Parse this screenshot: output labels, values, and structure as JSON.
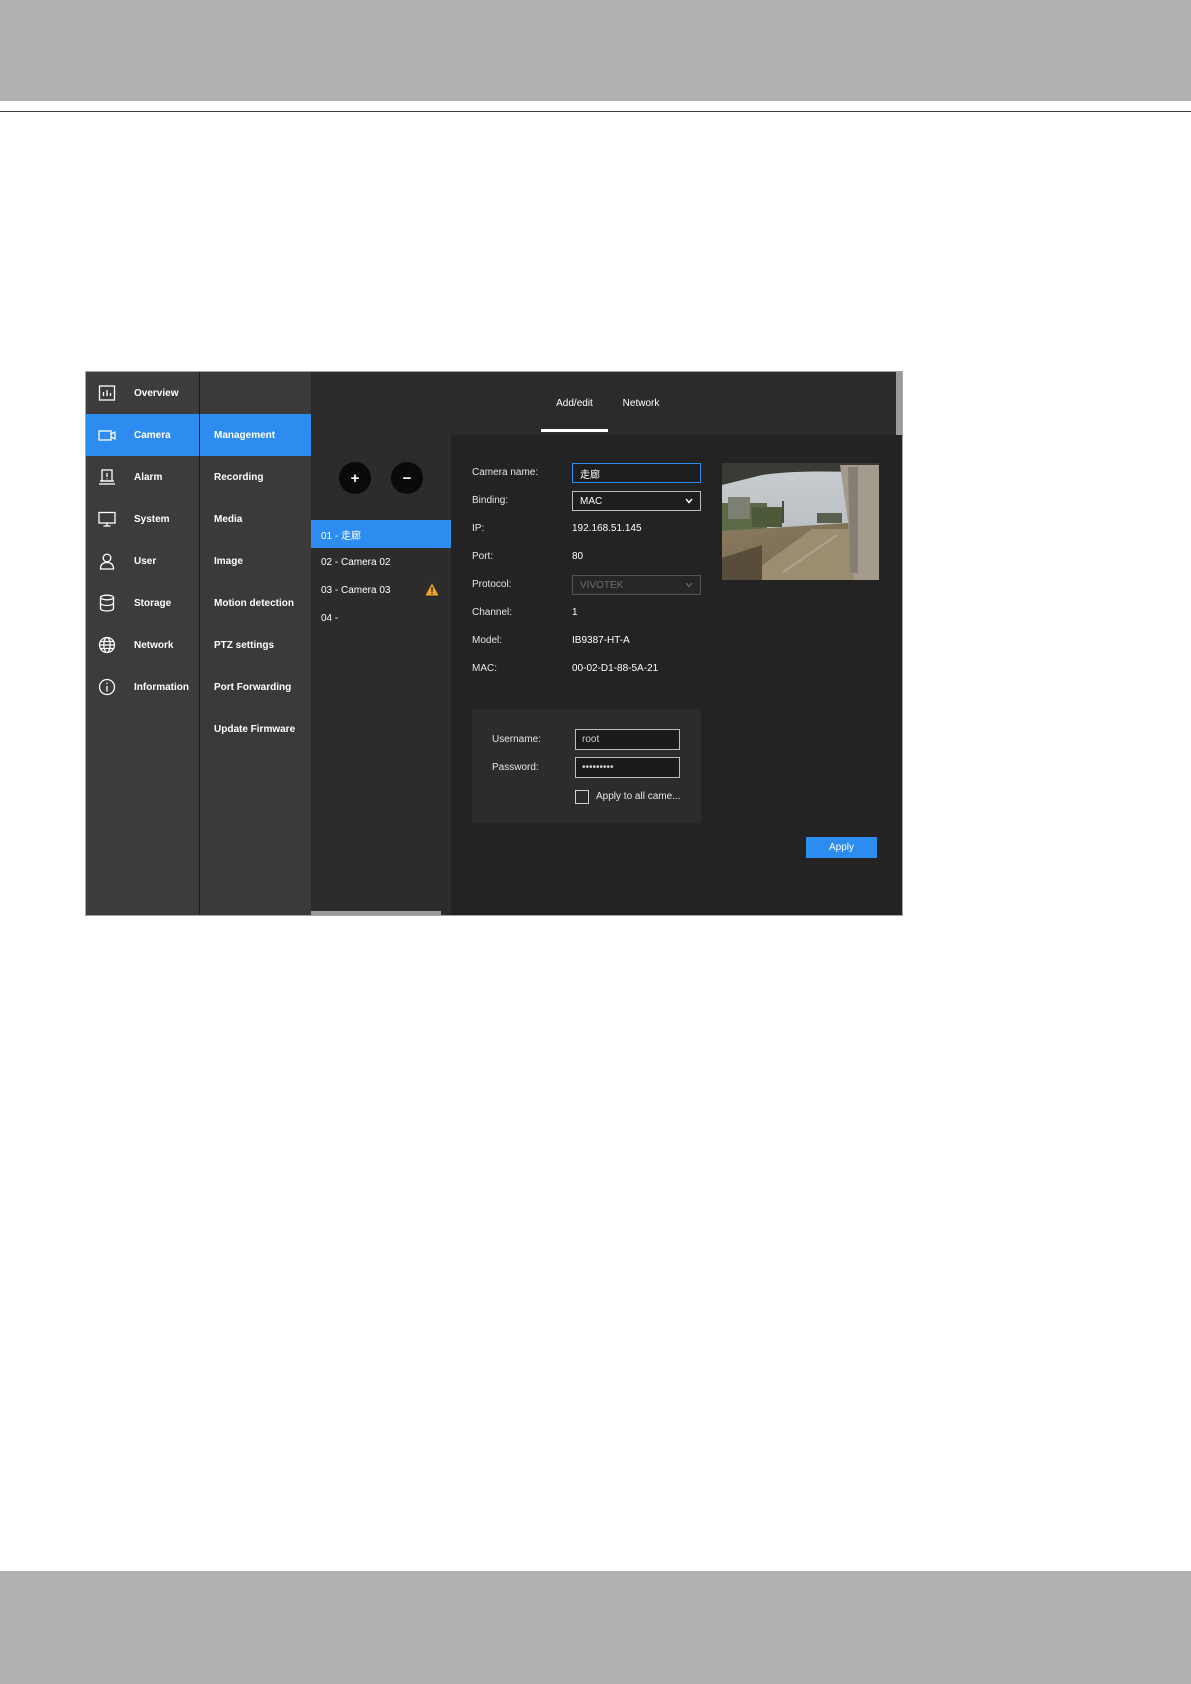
{
  "nav": {
    "items": [
      {
        "label": "Overview",
        "icon": "overview-chart-icon"
      },
      {
        "label": "Camera",
        "icon": "camera-icon"
      },
      {
        "label": "Alarm",
        "icon": "alarm-icon"
      },
      {
        "label": "System",
        "icon": "monitor-icon"
      },
      {
        "label": "User",
        "icon": "user-icon"
      },
      {
        "label": "Storage",
        "icon": "database-icon"
      },
      {
        "label": "Network",
        "icon": "globe-icon"
      },
      {
        "label": "Information",
        "icon": "info-icon"
      }
    ],
    "active": "Camera"
  },
  "subnav": {
    "items": [
      "Management",
      "Recording",
      "Media",
      "Image",
      "Motion detection",
      "PTZ settings",
      "Port Forwarding",
      "Update Firmware"
    ],
    "active": "Management"
  },
  "tabs": [
    "Add/edit",
    "Network"
  ],
  "active_tab": "Add/edit",
  "list": {
    "add_label": "+",
    "remove_label": "−",
    "cameras": [
      "01 - 走廊",
      "02 - Camera 02",
      "03 - Camera 03",
      "04 -"
    ],
    "warning_icon": "warning-icon"
  },
  "detail": {
    "camera_name_label": "Camera name:",
    "camera_name_value": "走廊",
    "binding_label": "Binding:",
    "binding_value": "MAC",
    "ip_label": "IP:",
    "ip_value": "192.168.51.145",
    "port_label": "Port:",
    "port_value": "80",
    "protocol_label": "Protocol:",
    "protocol_value": "VIVOTEK",
    "channel_label": "Channel:",
    "channel_value": "1",
    "model_label": "Model:",
    "model_value": "IB9387-HT-A",
    "mac_label": "MAC:",
    "mac_value": "00-02-D1-88-5A-21"
  },
  "credentials": {
    "username_label": "Username:",
    "username_value": "root",
    "password_label": "Password:",
    "password_value": "•••••••••",
    "apply_all_label": "Apply to all came..."
  },
  "apply_label": "Apply",
  "colors": {
    "accent": "#2d8cf0",
    "warning": "#f5a623",
    "page_band": "#b1b1b1"
  }
}
